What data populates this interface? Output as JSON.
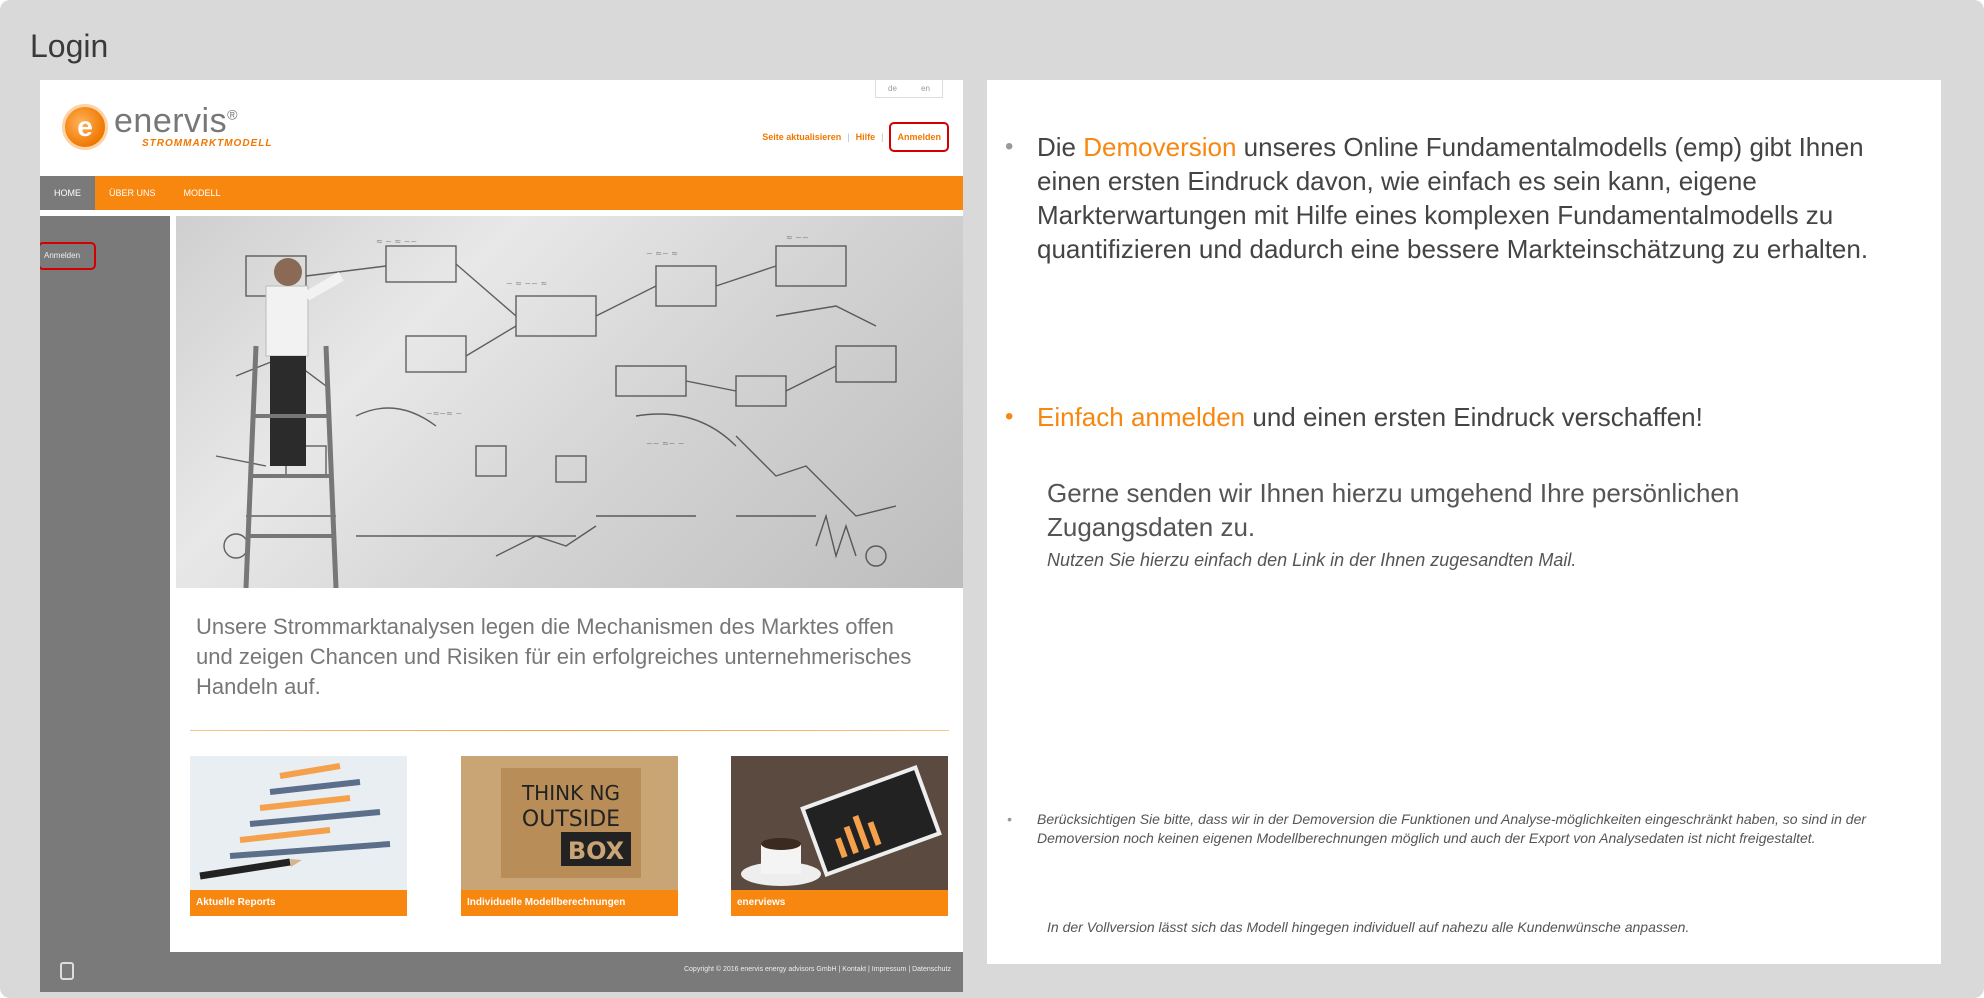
{
  "window": {
    "title": "Login"
  },
  "site": {
    "logo": {
      "mark": "e",
      "name": "enervis",
      "registered": "®",
      "subtitle": "STROMMARKTMODELL"
    },
    "language": [
      "de",
      "en"
    ],
    "header_links": [
      "Seite aktualisieren",
      "Hilfe",
      "Anmelden"
    ],
    "nav": [
      "HOME",
      "ÜBER UNS",
      "MODELL"
    ],
    "sidebar_login": "Anmelden",
    "tagline": "Unsere Strommarktanalysen legen die Mechanismen des Marktes offen und zeigen Chancen und Risiken für ein erfolgreiches unternehmerisches Handeln auf.",
    "tiles": [
      {
        "label": "Aktuelle Reports",
        "image": "pencil-chart-image"
      },
      {
        "label": "Individuelle Modellberechnungen",
        "image": "thinking-outside-the-box-image",
        "image_text": [
          "THINK NG",
          "OUTSIDE",
          "BOX"
        ]
      },
      {
        "label": "enerviews",
        "image": "tablet-coffee-image"
      }
    ],
    "footer": "Copyright © 2016 enervis energy advisors GmbH  |  Kontakt  |  Impressum  |  Datenschutz"
  },
  "panel": {
    "bullet1": {
      "prefix": "Die ",
      "highlight": "Demoversion",
      "rest": " unseres Online Fundamentalmodells (emp) gibt Ihnen einen ersten Eindruck davon, wie einfach es sein kann, eigene Markterwartungen mit Hilfe eines komplexen Fundamentalmodells zu quantifizieren und dadurch eine bessere Markteinschätzung zu erhalten."
    },
    "bullet2": {
      "highlight": "Einfach anmelden",
      "rest": " und einen ersten Eindruck verschaffen!"
    },
    "para": "Gerne senden wir Ihnen hierzu umgehend Ihre persönlichen Zugangsdaten zu.",
    "para_italic": "Nutzen Sie hierzu einfach den Link in der Ihnen zugesandten Mail.",
    "note": "Berücksichtigen Sie bitte, dass wir in der Demoversion die Funktionen und Analyse-möglichkeiten eingeschränkt haben, so sind in der Demoversion noch keinen eigenen Modellberechnungen möglich und auch der Export von Analysedaten ist nicht freigestaltet.",
    "note2": "In der Vollversion lässt sich das Modell hingegen individuell auf nahezu alle Kundenwünsche anpassen."
  },
  "colors": {
    "accent": "#f7870f",
    "sidebar": "#7a7a7a",
    "highlight_border": "#d40000"
  }
}
